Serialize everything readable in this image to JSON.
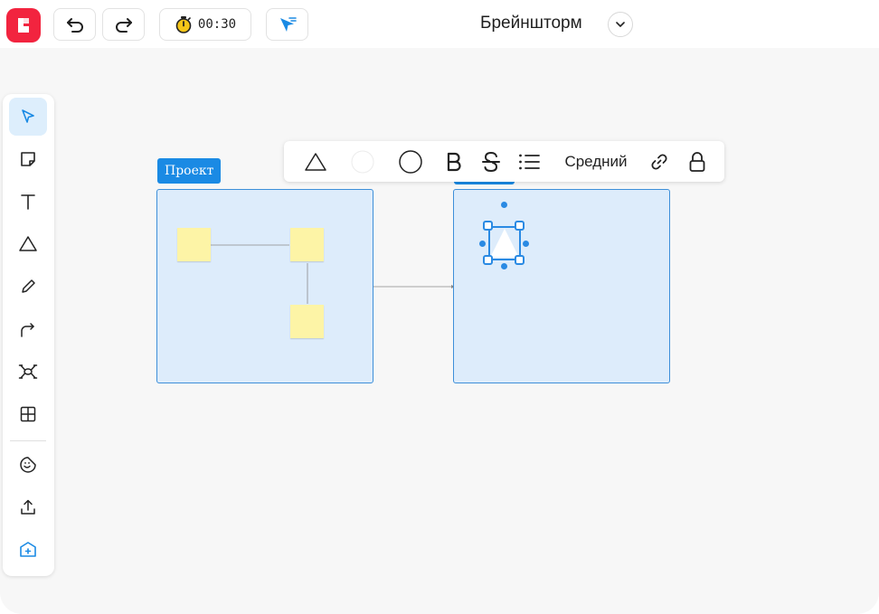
{
  "topbar": {
    "timer": "00:30",
    "board_title": "Брейншторм"
  },
  "left_toolbar": {
    "tools": [
      "select-tool",
      "sticky-note-tool",
      "text-tool",
      "shape-tool",
      "pen-tool",
      "connector-tool",
      "mindmap-tool",
      "table-tool",
      "sticker-tool",
      "upload-tool",
      "template-tool"
    ],
    "active": "select-tool"
  },
  "frames": [
    {
      "label": "Проект"
    }
  ],
  "context_toolbar": {
    "size_label": "Средний"
  },
  "colors": {
    "brand": "#f2243f",
    "accent": "#1a8ae4",
    "frame_fill": "#ddecfb",
    "sticky": "#fdf4a6"
  }
}
